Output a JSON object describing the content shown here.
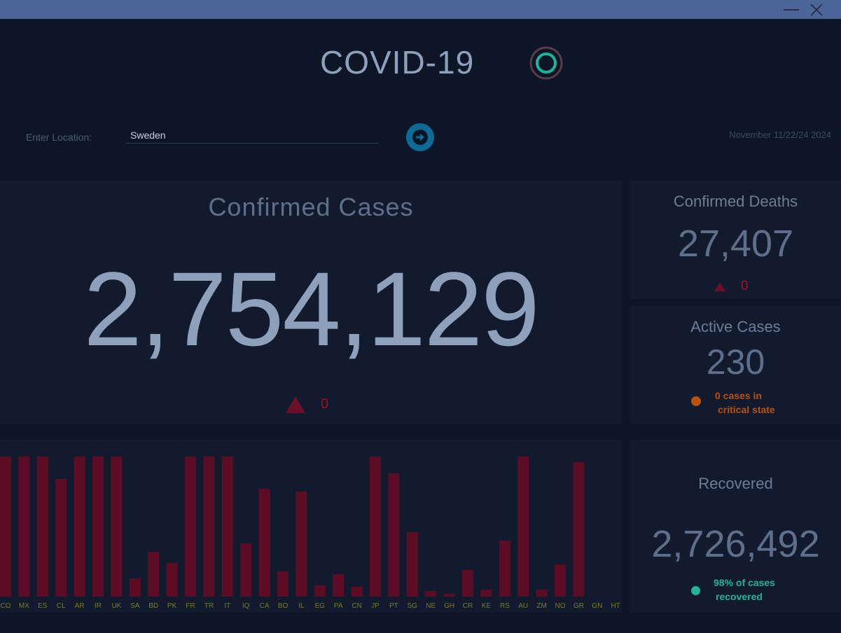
{
  "window": {
    "minimize_icon": "minimize-icon",
    "close_icon": "close-icon"
  },
  "header": {
    "title": "COVID-19",
    "logo_icon": "ring-logo-icon"
  },
  "search": {
    "label": "Enter Location:",
    "value": "Sweden",
    "submit_icon": "arrow-right-icon",
    "date": "November 11/22/24 2024"
  },
  "confirmed": {
    "label": "Confirmed Cases",
    "value": "2,754,129",
    "delta": "0"
  },
  "deaths": {
    "label": "Confirmed Deaths",
    "value": "27,407",
    "delta": "0"
  },
  "active": {
    "label": "Active Cases",
    "value": "230",
    "note_line1": "0 cases in",
    "note_line2": "critical state"
  },
  "recovered": {
    "label": "Recovered",
    "value": "2,726,492",
    "note_line1": "98% of cases",
    "note_line2": "recovered"
  },
  "colors": {
    "bar": "#5c0c24",
    "tick": "#7a7a2a",
    "critical": "#b8520f",
    "recovered": "#1eb49a",
    "delta": "#9e1422"
  },
  "chart_data": {
    "type": "bar",
    "categories": [
      "CO",
      "MX",
      "ES",
      "CL",
      "AR",
      "IR",
      "UK",
      "SA",
      "BD",
      "PK",
      "FR",
      "TR",
      "IT",
      "IQ",
      "CA",
      "BO",
      "IL",
      "EG",
      "PA",
      "CN",
      "JP",
      "PT",
      "SG",
      "NE",
      "GH",
      "CR",
      "KE",
      "RS",
      "AU",
      "ZM",
      "NO",
      "GR",
      "GN",
      "HT"
    ],
    "values": [
      100,
      100,
      100,
      84,
      100,
      100,
      100,
      13,
      32,
      24,
      100,
      100,
      100,
      38,
      77,
      18,
      75,
      8,
      16,
      7,
      100,
      88,
      46,
      4,
      2,
      19,
      5,
      40,
      100,
      5,
      23,
      96,
      0,
      0
    ],
    "ylim": [
      0,
      100
    ],
    "grid": false,
    "legend": "none"
  }
}
